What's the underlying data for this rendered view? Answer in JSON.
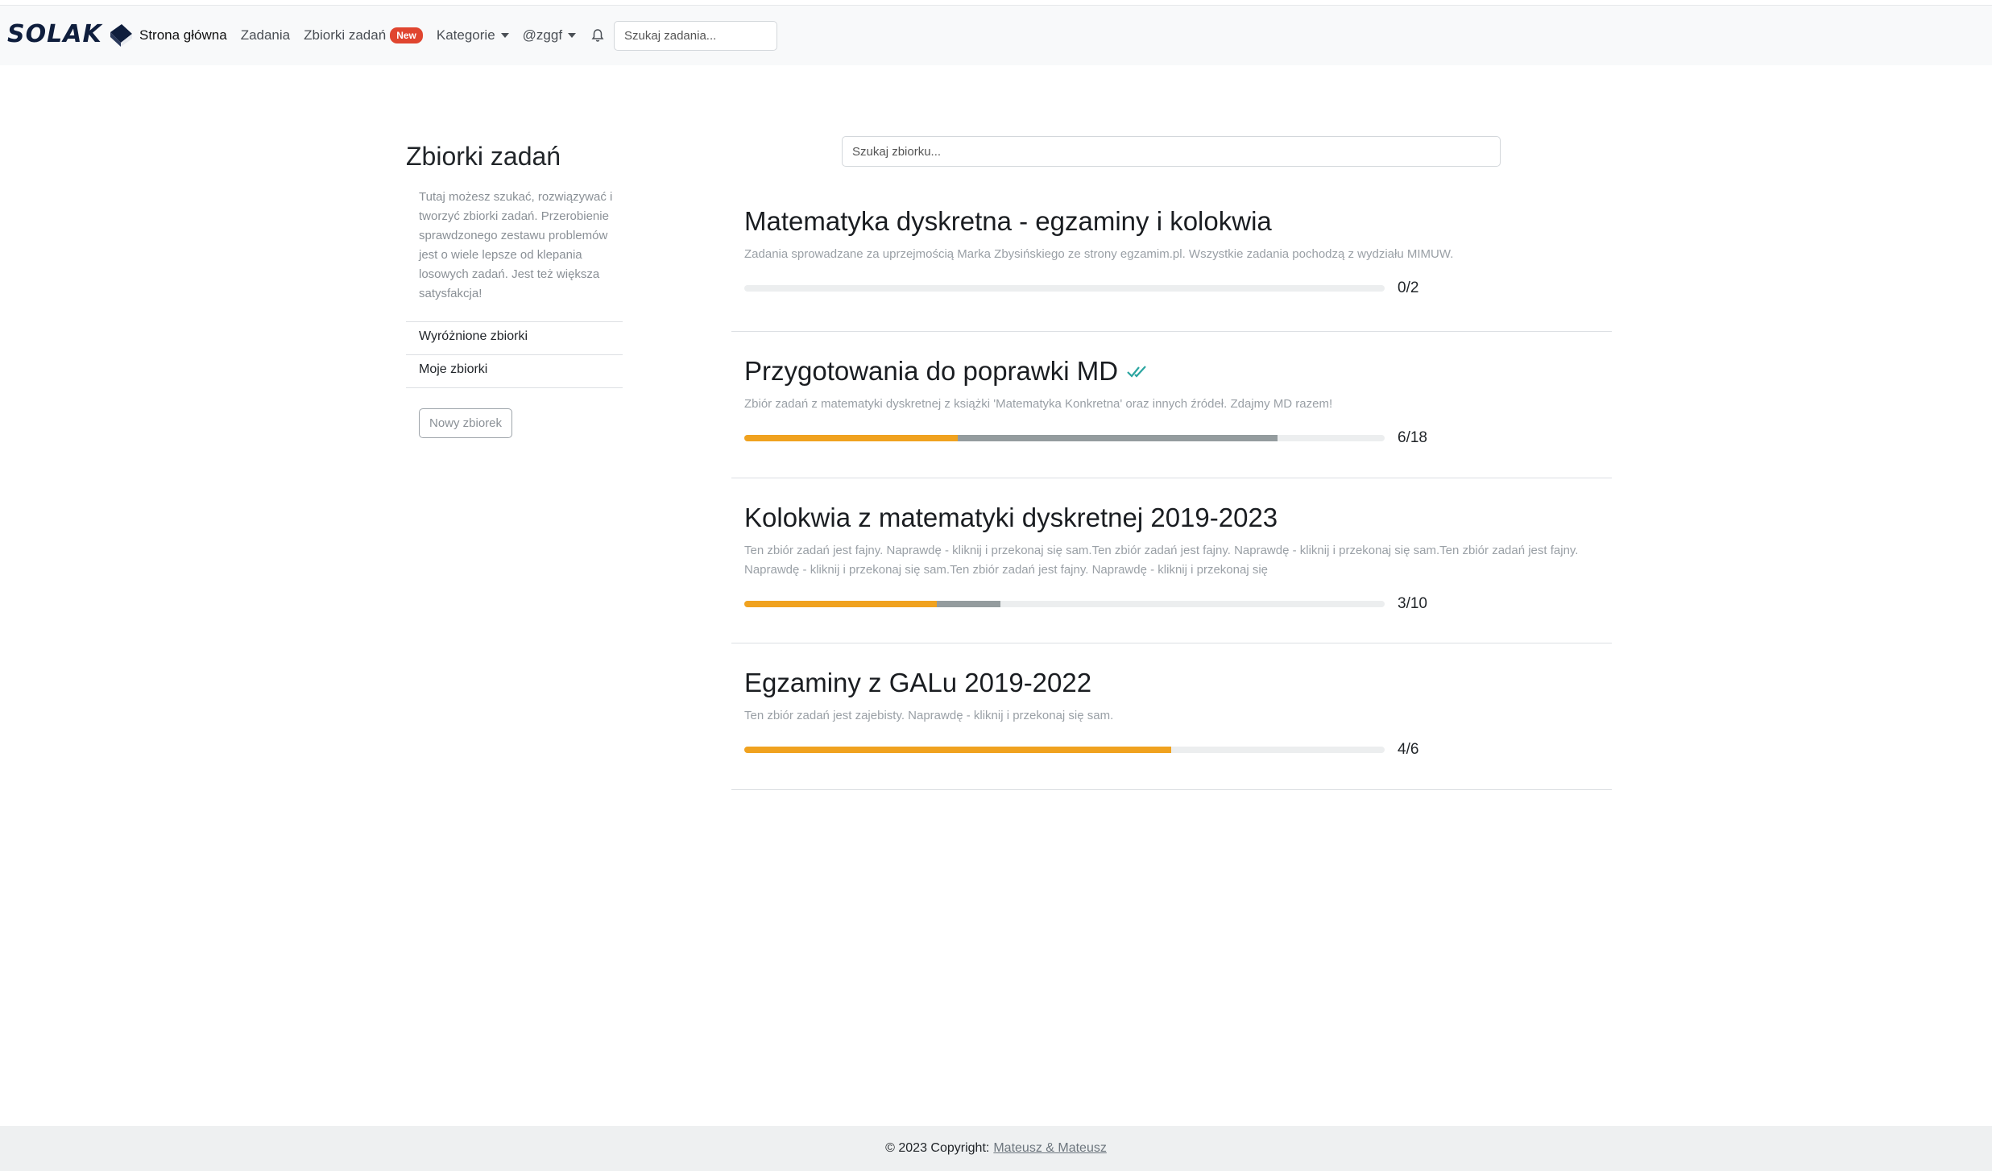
{
  "navbar": {
    "brand": "SOLAK",
    "links": [
      {
        "label": "Strona główna",
        "active": true
      },
      {
        "label": "Zadania"
      },
      {
        "label": "Zbiorki zadań",
        "badge": "New"
      },
      {
        "label": "Kategorie",
        "dropdown": true
      },
      {
        "label": "@zggf",
        "dropdown": true
      }
    ],
    "search_placeholder": "Szukaj zadania..."
  },
  "sidebar": {
    "title": "Zbiorki zadań",
    "description": "Tutaj możesz szukać, rozwiązywać i tworzyć zbiorki zadań. Przerobienie sprawdzonego zestawu problemów jest o wiele lepsze od klepania losowych zadań. Jest też większa satysfakcja!",
    "items": [
      "Wyróżnione zbiorki",
      "Moje zbiorki"
    ],
    "new_button": "Nowy zbiorek"
  },
  "collection_search_placeholder": "Szukaj zbiorku...",
  "collections": [
    {
      "title": "Matematyka dyskretna - egzaminy i kolokwia",
      "description": "Zadania sprowadzane za uprzejmością Marka Zbysińskiego ze strony egzamim.pl. Wszystkie zadania pochodzą z wydziału MIMUW.",
      "solved": 0,
      "attempted": 0,
      "total": 2,
      "count": "0/2",
      "completed_mark": false
    },
    {
      "title": "Przygotowania do poprawki MD",
      "description": "Zbiór zadań z matematyki dyskretnej z książki 'Matematyka Konkretna' oraz innych źródeł. Zdajmy MD razem!",
      "solved": 6,
      "attempted": 9,
      "total": 18,
      "count": "6/18",
      "completed_mark": true
    },
    {
      "title": "Kolokwia z matematyki dyskretnej 2019-2023",
      "description": "Ten zbiór zadań jest fajny. Naprawdę - kliknij i przekonaj się sam.Ten zbiór zadań jest fajny. Naprawdę - kliknij i przekonaj się sam.Ten zbiór zadań jest fajny. Naprawdę - kliknij i przekonaj się sam.Ten zbiór zadań jest fajny. Naprawdę - kliknij i przekonaj się",
      "solved": 3,
      "attempted": 1,
      "total": 10,
      "count": "3/10",
      "completed_mark": false
    },
    {
      "title": "Egzaminy z GALu 2019-2022",
      "description": "Ten zbiór zadań jest zajebisty. Naprawdę - kliknij i przekonaj się sam.",
      "solved": 4,
      "attempted": 0,
      "total": 6,
      "count": "4/6",
      "completed_mark": false
    }
  ],
  "colors": {
    "solved": "#f0a21f",
    "attempted": "#949c9e",
    "badge": "#e0452f",
    "check": "#2aa5a0"
  },
  "footer": {
    "copyright": "© 2023 Copyright:",
    "authors": "Mateusz & Mateusz"
  }
}
